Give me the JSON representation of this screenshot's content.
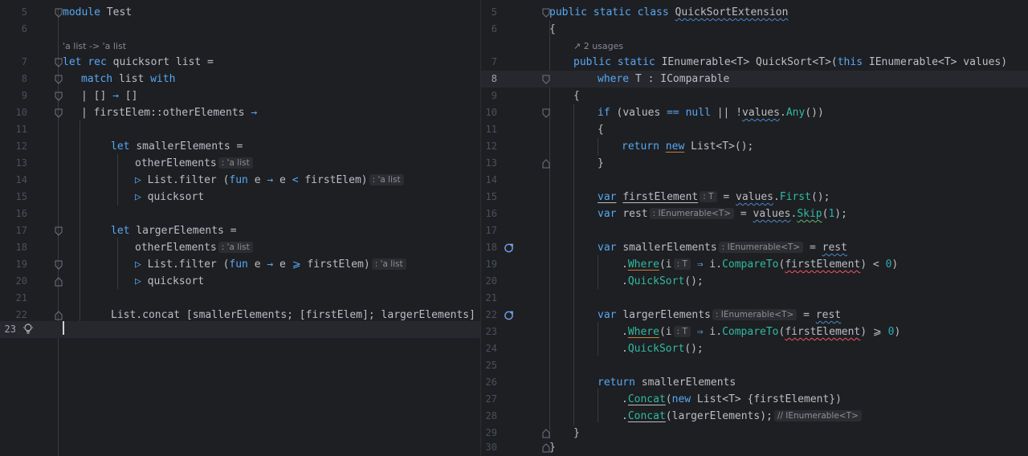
{
  "left": {
    "lines": [
      {
        "n": "5"
      },
      {
        "n": "6"
      },
      {
        "n": "7"
      },
      {
        "n": "8"
      },
      {
        "n": "9"
      },
      {
        "n": "10"
      },
      {
        "n": "11"
      },
      {
        "n": "12"
      },
      {
        "n": "13"
      },
      {
        "n": "14"
      },
      {
        "n": "15"
      },
      {
        "n": "16"
      },
      {
        "n": "17"
      },
      {
        "n": "18"
      },
      {
        "n": "19"
      },
      {
        "n": "20"
      },
      {
        "n": "21"
      },
      {
        "n": "22"
      },
      {
        "n": "23"
      }
    ],
    "type_hint": "'a list -> 'a list",
    "code": {
      "l5_kw": "module",
      "l5_name": "Test",
      "l7_kw1": "let",
      "l7_kw2": "rec",
      "l7_rest": "quicksort list =",
      "l8_kw1": "match",
      "l8_mid": "list",
      "l8_kw2": "with",
      "l9_a": "| [] ",
      "l9_arrow": "→",
      "l9_b": " []",
      "l10_a": "| firstElem::otherElements ",
      "l10_arrow": "→",
      "l12_kw": "let",
      "l12_rest": "smallerElements =",
      "l13_a": "otherElements",
      "l13_hint": ": 'a list",
      "l14_pipe": "▷",
      "l14_a": "List.filter (",
      "l14_kw": "fun",
      "l14_b": " e ",
      "l14_arrow": "→",
      "l14_c": " e ",
      "l14_op": "<",
      "l14_d": " firstElem)",
      "l14_hint": ": 'a list",
      "l15_pipe": "▷",
      "l15_a": "quicksort",
      "l17_kw": "let",
      "l17_rest": "largerElements =",
      "l18_a": "otherElements",
      "l18_hint": ": 'a list",
      "l19_pipe": "▷",
      "l19_a": "List.filter (",
      "l19_kw": "fun",
      "l19_b": " e ",
      "l19_arrow": "→",
      "l19_c": " e ",
      "l19_op": "⩾",
      "l19_d": " firstElem)",
      "l19_hint": ": 'a list",
      "l20_pipe": "▷",
      "l20_a": "quicksort",
      "l22_a": "List.concat [smallerElements; [firstElem]; largerElements]"
    }
  },
  "right": {
    "lines": [
      {
        "n": "5"
      },
      {
        "n": "6"
      },
      {
        "n": "7"
      },
      {
        "n": "8"
      },
      {
        "n": "9"
      },
      {
        "n": "10"
      },
      {
        "n": "11"
      },
      {
        "n": "12"
      },
      {
        "n": "13"
      },
      {
        "n": "14"
      },
      {
        "n": "15"
      },
      {
        "n": "16"
      },
      {
        "n": "17"
      },
      {
        "n": "18"
      },
      {
        "n": "19"
      },
      {
        "n": "20"
      },
      {
        "n": "21"
      },
      {
        "n": "22"
      },
      {
        "n": "23"
      },
      {
        "n": "24"
      },
      {
        "n": "25"
      },
      {
        "n": "26"
      },
      {
        "n": "27"
      },
      {
        "n": "28"
      },
      {
        "n": "29"
      },
      {
        "n": "30"
      }
    ],
    "usages": "2 usages",
    "code": {
      "r5_kw": "public static class",
      "r5_name": "QuickSortExtension",
      "r6": "{",
      "r7_kw1": "public static",
      "r7_a": " IEnumerable<T> QuickSort<T>(",
      "r7_kw2": "this",
      "r7_b": " IEnumerable<T> values)",
      "r8_kw": "where",
      "r8_a": " T : IComparable",
      "r9": "{",
      "r10_kw": "if",
      "r10_a": " (",
      "r10_v": "values",
      "r10_b": " ",
      "r10_op": "==",
      "r10_c": " ",
      "r10_null": "null",
      "r10_d": " || !",
      "r10_v2": "values",
      "r10_e": ".",
      "r10_m": "Any",
      "r10_f": "())",
      "r11": "{",
      "r12_kw": "return",
      "r12_new": "new",
      "r12_a": " List<T>();",
      "r13": "}",
      "r15_kw": "var",
      "r15_name": "firstElement",
      "r15_hint": ": T",
      "r15_a": " = ",
      "r15_v": "values",
      "r15_b": ".",
      "r15_m": "First",
      "r15_c": "();",
      "r16_kw": "var",
      "r16_name": "rest",
      "r16_hint": ": IEnumerable<T>",
      "r16_a": " = ",
      "r16_v": "values",
      "r16_b": ".",
      "r16_m": "Skip",
      "r16_c": "(",
      "r16_n": "1",
      "r16_d": ");",
      "r18_kw": "var",
      "r18_name": "smallerElements",
      "r18_hint": ": IEnumerable<T>",
      "r18_a": " = ",
      "r18_v": "rest",
      "r19_a": ".",
      "r19_m": "Where",
      "r19_b": "(i",
      "r19_hint": ": T",
      "r19_arrow": " ⇒ ",
      "r19_c": "i.",
      "r19_m2": "CompareTo",
      "r19_d": "(",
      "r19_v": "firstElement",
      "r19_e": ") < ",
      "r19_n": "0",
      "r19_f": ")",
      "r20_a": ".",
      "r20_m": "QuickSort",
      "r20_b": "();",
      "r22_kw": "var",
      "r22_name": "largerElements",
      "r22_hint": ": IEnumerable<T>",
      "r22_a": " = ",
      "r22_v": "rest",
      "r23_a": ".",
      "r23_m": "Where",
      "r23_b": "(i",
      "r23_hint": ": T",
      "r23_arrow": " ⇒ ",
      "r23_c": "i.",
      "r23_m2": "CompareTo",
      "r23_d": "(",
      "r23_v": "firstElement",
      "r23_e": ") ⩾ ",
      "r23_n": "0",
      "r23_f": ")",
      "r24_a": ".",
      "r24_m": "QuickSort",
      "r24_b": "();",
      "r26_kw": "return",
      "r26_a": " smallerElements",
      "r27_a": ".",
      "r27_m": "Concat",
      "r27_b": "(",
      "r27_new": "new",
      "r27_c": " List<T> {firstElement})",
      "r28_a": ".",
      "r28_m": "Concat",
      "r28_b": "(largerElements);",
      "r28_hint": "// IEnumerable<T>",
      "r29": "}",
      "r30": "}"
    }
  }
}
